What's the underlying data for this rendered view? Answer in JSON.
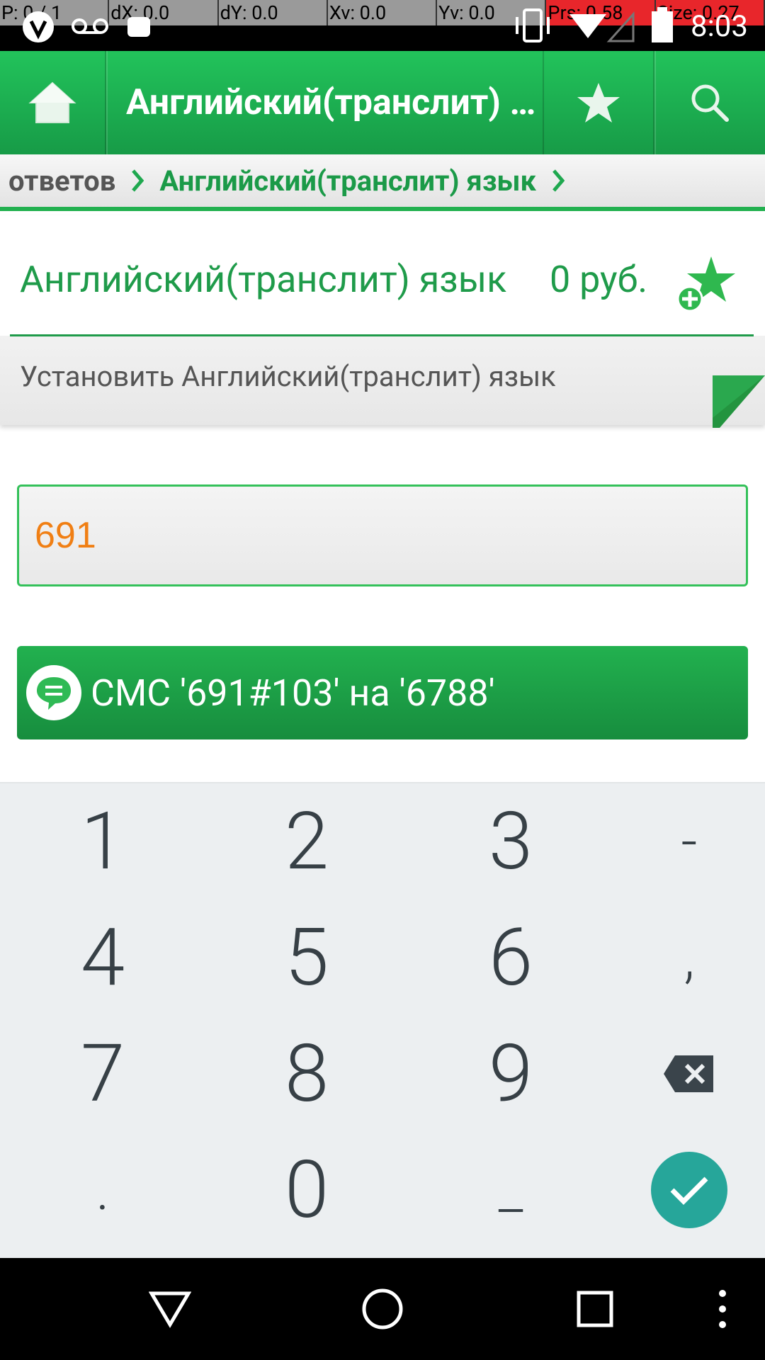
{
  "status_bar": {
    "debug": [
      "P: 0 / 1",
      "dX: 0.0",
      "dY: 0.0",
      "Xv: 0.0",
      "Yv: 0.0",
      "Prs: 0.58",
      "Size: 0.27"
    ],
    "time": "8:03"
  },
  "app_bar": {
    "title": "Английский(транслит) язык",
    "home_icon": "home-icon",
    "favorite_icon": "star-icon",
    "search_icon": "search-icon"
  },
  "breadcrumb": {
    "previous": "ответов",
    "current": "Английский(транслит) язык"
  },
  "header": {
    "title": "Английский(транслит) язык",
    "price": "0 руб.",
    "install_text": "Установить Английский(транслит) язык"
  },
  "input": {
    "value": "691"
  },
  "sms_button": {
    "label": "СМС '691#103' на '6788'"
  },
  "keypad": {
    "keys": [
      "1",
      "2",
      "3",
      "-",
      "4",
      "5",
      "6",
      ",",
      "7",
      "8",
      "9",
      "backspace",
      ".",
      "0",
      "_",
      "done"
    ]
  },
  "colors": {
    "brand_green": "#1f9b4a",
    "input_text": "#f07f14",
    "done_teal": "#26a69a"
  }
}
